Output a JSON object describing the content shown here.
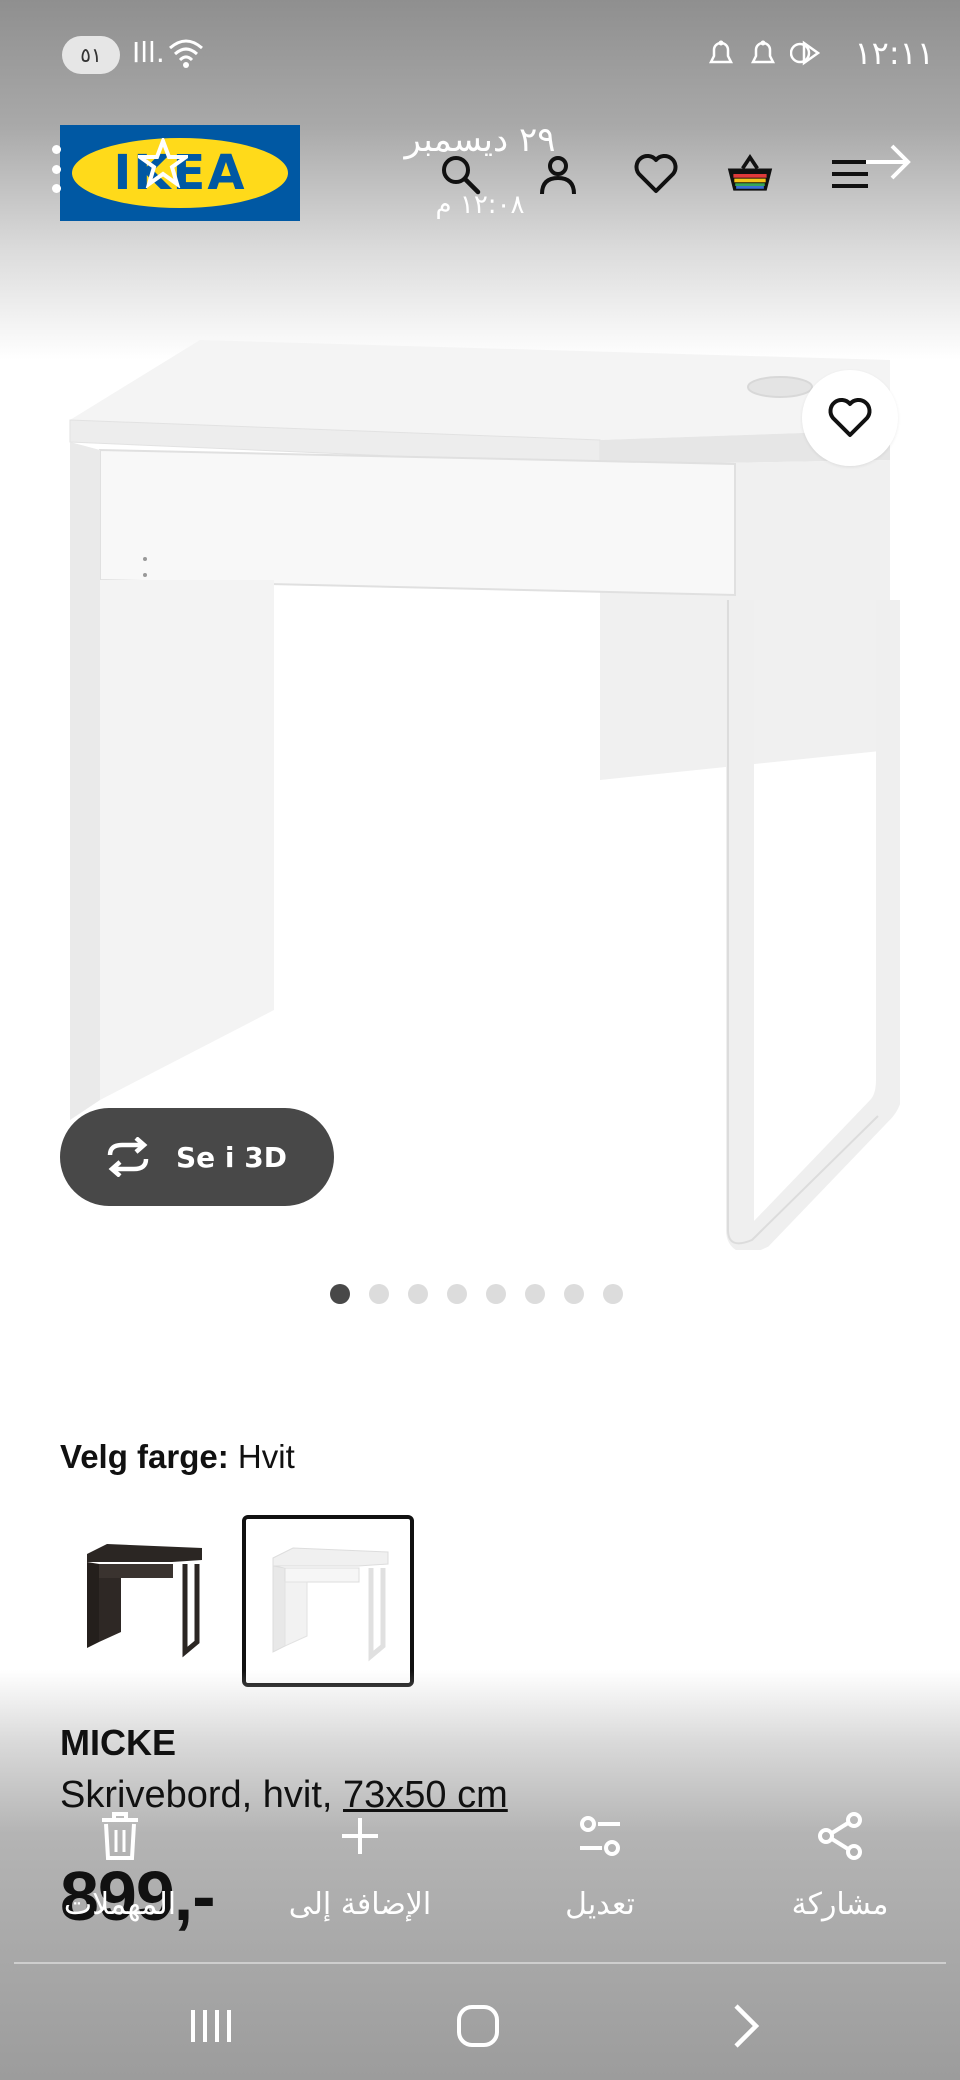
{
  "status_bar": {
    "battery_pill": "٥١",
    "signal_text": "Ill.",
    "wifi_text": "5",
    "time": "١٢:١١"
  },
  "header": {
    "logo_text": "IKEA",
    "overlay_date": "٢٩ ديسمبر",
    "overlay_time": "١٢:٠٨ م",
    "icons": [
      "search-icon",
      "account-icon",
      "favorites-icon",
      "basket-icon",
      "menu-icon"
    ]
  },
  "gallery": {
    "button_3d_label": "Se i 3D",
    "page_count": 8,
    "active_page": 1
  },
  "color_select": {
    "label": "Velg farge:",
    "value": "Hvit",
    "options": [
      "black-brown",
      "white"
    ],
    "selected": "white"
  },
  "product": {
    "name": "MICKE",
    "description": "Skrivebord, hvit,",
    "size": "73x50 cm",
    "price": "899,-"
  },
  "action_overlay": {
    "delete_label": "المهملات",
    "add_label": "الإضافة إلى",
    "edit_label": "تعديل",
    "share_label": "مشاركة"
  },
  "colors": {
    "ikea_blue": "#0058a3",
    "ikea_yellow": "#ffda1a",
    "dark_button": "#484848"
  }
}
